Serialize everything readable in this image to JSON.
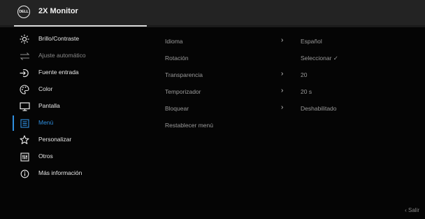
{
  "header": {
    "logo_text": "DELL",
    "title": "2X Monitor"
  },
  "menu": {
    "items": [
      {
        "label": "Brillo/Contraste",
        "icon": "sun-icon"
      },
      {
        "label": "Ajuste automático",
        "icon": "auto-adjust-icon"
      },
      {
        "label": "Fuente entrada",
        "icon": "input-source-icon"
      },
      {
        "label": "Color",
        "icon": "palette-icon"
      },
      {
        "label": "Pantalla",
        "icon": "display-icon"
      },
      {
        "label": "Menú",
        "icon": "menu-icon"
      },
      {
        "label": "Personalizar",
        "icon": "star-icon"
      },
      {
        "label": "Otros",
        "icon": "others-icon"
      },
      {
        "label": "Más información",
        "icon": "info-icon"
      }
    ],
    "active_index": 5,
    "active_color": "#2f8fe0"
  },
  "settings": {
    "rows": [
      {
        "name": "Idioma",
        "value": "Español"
      },
      {
        "name": "Rotación",
        "value": "Seleccionar ✓"
      },
      {
        "name": "Transparencia",
        "value": "20"
      },
      {
        "name": "Temporizador",
        "value": "20 s"
      },
      {
        "name": "Bloquear",
        "value": "Deshabilitado"
      },
      {
        "name": "Restablecer menú",
        "value": ""
      }
    ],
    "arrow": "›"
  },
  "footer": {
    "exit_label": "‹  Salir"
  }
}
